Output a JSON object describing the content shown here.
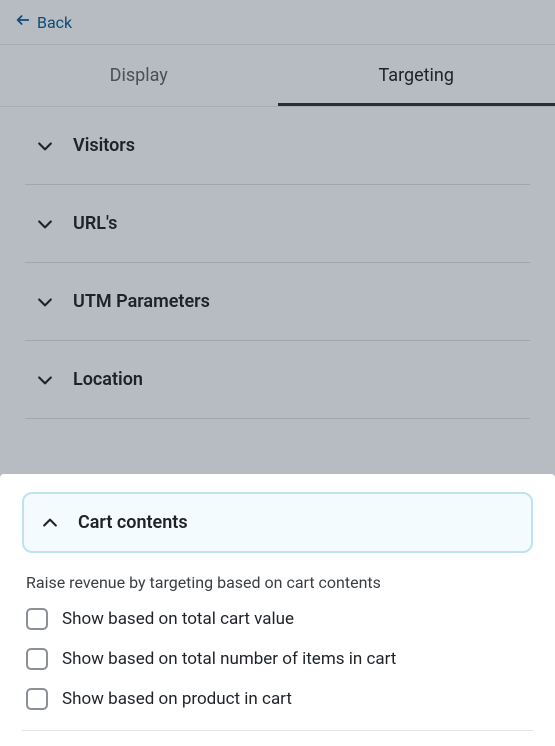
{
  "header": {
    "back_label": "Back"
  },
  "tabs": [
    {
      "label": "Display",
      "active": false
    },
    {
      "label": "Targeting",
      "active": true
    }
  ],
  "sections": [
    {
      "title": "Visitors",
      "expanded": false
    },
    {
      "title": "URL's",
      "expanded": false
    },
    {
      "title": "UTM Parameters",
      "expanded": false
    },
    {
      "title": "Location",
      "expanded": false
    }
  ],
  "expanded_section": {
    "title": "Cart contents",
    "description": "Raise revenue by targeting based on cart contents",
    "options": [
      {
        "label": "Show based on total cart value",
        "checked": false
      },
      {
        "label": "Show based on total number of items in cart",
        "checked": false
      },
      {
        "label": "Show based on product in cart",
        "checked": false
      }
    ]
  }
}
